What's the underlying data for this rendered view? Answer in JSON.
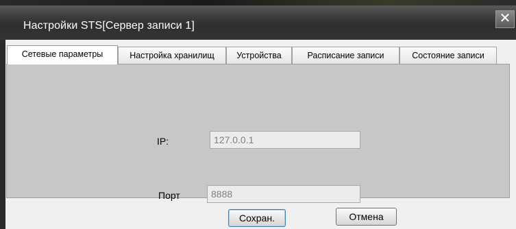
{
  "window": {
    "title": "Настройки STS[Сервер записи 1]",
    "close_glyph": "✕"
  },
  "tabs": [
    {
      "label": "Сетевые параметры",
      "active": true
    },
    {
      "label": "Настройка хранилищ",
      "active": false
    },
    {
      "label": "Устройства",
      "active": false
    },
    {
      "label": "Расписание записи",
      "active": false
    },
    {
      "label": "Состояние записи",
      "active": false
    }
  ],
  "network": {
    "ip_label": "IP:",
    "ip_value": "127.0.0.1",
    "port_label": "Порт",
    "port_value": "8888"
  },
  "buttons": {
    "save_label": "Сохран.",
    "cancel_label": "Отмена"
  }
}
